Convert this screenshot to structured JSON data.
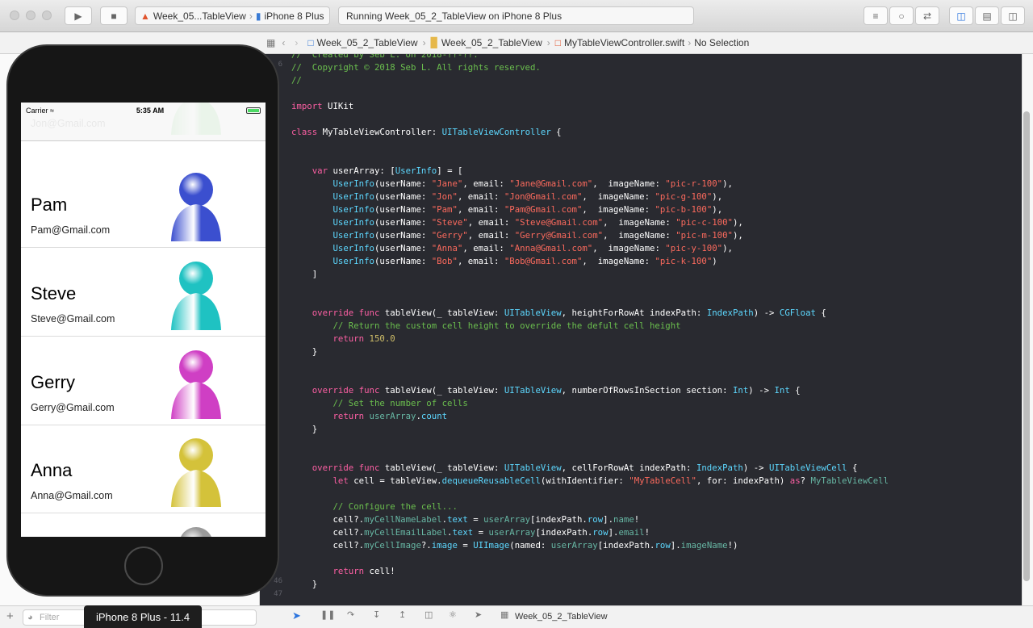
{
  "toolbar": {
    "scheme_target": "Week_05...TableView",
    "scheme_device": "iPhone 8 Plus",
    "activity": "Running Week_05_2_TableView on iPhone 8 Plus",
    "icons": [
      "run-icon",
      "stop-icon",
      "standard-editor-icon",
      "assistant-editor-icon",
      "version-editor-icon",
      "navigator-toggle-icon",
      "debug-toggle-icon",
      "inspector-toggle-icon"
    ]
  },
  "jumpbar": {
    "crumbs": [
      "Week_05_2_TableView",
      "Week_05_2_TableView",
      "MyTableViewController.swift",
      "No Selection"
    ]
  },
  "editor": {
    "line_numbers": [
      "46",
      "47"
    ]
  },
  "bottom": {
    "filter_placeholder": "Filter",
    "scheme_name": "Week_05_2_TableView"
  },
  "simulator": {
    "device_label": "iPhone 8 Plus - 11.4",
    "status": {
      "carrier": "Carrier",
      "time": "5:35 AM"
    },
    "cells": [
      {
        "name": "",
        "email": "Jon@Gmail.com",
        "color": "#3fbf3f"
      },
      {
        "name": "Pam",
        "email": "Pam@Gmail.com",
        "color": "#3b4fcf"
      },
      {
        "name": "Steve",
        "email": "Steve@Gmail.com",
        "color": "#1fc2c2"
      },
      {
        "name": "Gerry",
        "email": "Gerry@Gmail.com",
        "color": "#cf3fc4"
      },
      {
        "name": "Anna",
        "email": "Anna@Gmail.com",
        "color": "#d4c23a"
      },
      {
        "name": "",
        "email": "",
        "color": "#9a9a9a"
      }
    ]
  },
  "colors": {
    "editor_bg": "#292a30",
    "keyword": "#fc5fa3",
    "type": "#5dd8ff",
    "string": "#fc6a5d",
    "comment": "#6bbf4e",
    "number": "#d0bf69"
  }
}
